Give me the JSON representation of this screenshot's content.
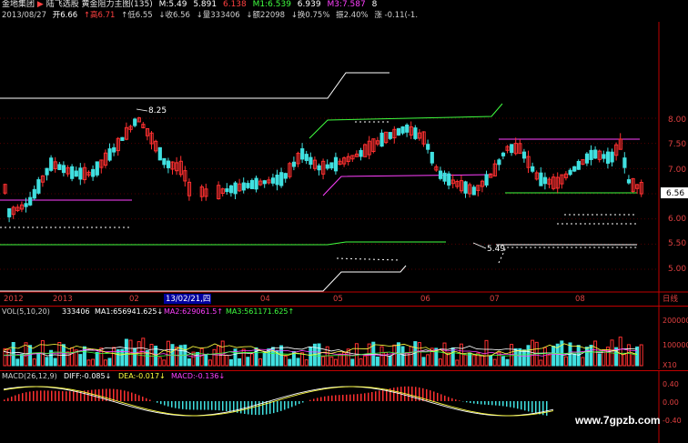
{
  "header": {
    "stock_name": "金地集团",
    "indicator_name": "陆飞选股 黄金阻力主图(135)",
    "m_values": [
      {
        "label": "M:5.49",
        "color": "#ffffff"
      },
      {
        "label": "5.891",
        "color": "#ffffff"
      },
      {
        "label": "6.138",
        "color": "#ff4040"
      },
      {
        "label": "M1:6.539",
        "color": "#40ff40"
      },
      {
        "label": "6.939",
        "color": "#ffffff"
      },
      {
        "label": "M3:7.587",
        "color": "#ff40ff"
      },
      {
        "label": "8",
        "color": "#ffffff"
      }
    ],
    "date": "2013/08/27",
    "quote": [
      {
        "label": "开6.66",
        "color": "#ffffff"
      },
      {
        "label": "↑高6.71",
        "color": "#ff4040"
      },
      {
        "label": "↑低6.55",
        "color": "#ffffff"
      },
      {
        "label": "↓收6.56",
        "color": "#ffffff"
      },
      {
        "label": "↓量333406",
        "color": "#ffffff"
      },
      {
        "label": "↓额22098",
        "color": "#ffffff"
      },
      {
        "label": "↓换0.75%",
        "color": "#ffffff"
      },
      {
        "label": "振2.40%",
        "color": "#ffffff"
      },
      {
        "label": "涨 -0.11(-1.",
        "color": "#ffffff"
      }
    ]
  },
  "price_axis": [
    "8.00",
    "7.50",
    "7.00",
    "6.56",
    "6.00",
    "5.50",
    "5.00"
  ],
  "current_price": "6.56",
  "annotations": {
    "high": "8.25",
    "low": "5.49"
  },
  "time_axis": {
    "labels": [
      "2012",
      "2013",
      "02",
      "04",
      "05",
      "06",
      "07",
      "08"
    ],
    "selected_date": "13/02/21,四",
    "period": "日线"
  },
  "volume_panel": {
    "title": "VOL(5,10,20)",
    "value": "333406",
    "ma": [
      {
        "label": "MA1:656941.625↓",
        "color": "#ffffff"
      },
      {
        "label": "MA2:629061.5↑",
        "color": "#ff40ff"
      },
      {
        "label": "MA3:561171.625↑",
        "color": "#40ff40"
      }
    ],
    "axis": [
      "200000",
      "100000",
      "X10"
    ]
  },
  "macd_panel": {
    "title": "MACD(26,12,9)",
    "items": [
      {
        "label": "DIFF:-0.085↓",
        "color": "#ffffff"
      },
      {
        "label": "DEA:-0.017↓",
        "color": "#ffff40"
      },
      {
        "label": "MACD:-0.136↓",
        "color": "#ff40ff"
      }
    ],
    "axis": [
      "0.40",
      "0.00",
      "-0.40"
    ]
  },
  "watermark": "www.7gpzb.com",
  "colors": {
    "up": "#ff3030",
    "down": "#40e0e0",
    "axis": "#c00000",
    "grid": "#800000"
  }
}
